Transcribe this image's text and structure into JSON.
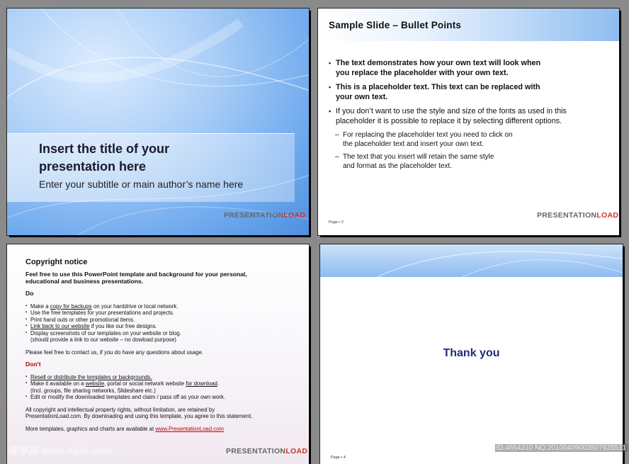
{
  "slide1": {
    "title_line1": "Insert the title of your",
    "title_line2": "presentation here",
    "subtitle": "Enter your subtitle or main author’s name here",
    "logo_a": "PRESENTATION",
    "logo_b": "LOAD"
  },
  "slide2": {
    "title": "Sample Slide – Bullet Points",
    "bullets": [
      {
        "l1": "The text demonstrates how your own text will look when",
        "l2": "you replace the placeholder with your own text."
      },
      {
        "l1": "This is a placeholder text. This text can be replaced with",
        "l2": "your own text."
      },
      {
        "l1": "If you don’t want to use the style and size of the fonts as used in this",
        "l2": "placeholder it is possible to replace it by selecting different options."
      }
    ],
    "subbullets": [
      {
        "l1": "For replacing the placeholder text you need to click on",
        "l2": "the placeholder text and insert your own text."
      },
      {
        "l1": "The text that you insert will retain the same style",
        "l2": "and format as the placeholder text."
      }
    ],
    "page": "Page ▪ 2",
    "logo_a": "PRESENTATION",
    "logo_b": "LOAD"
  },
  "slide3": {
    "title": "Copyright notice",
    "intro_l1": "Feel free to use this PowerPoint template and background for your personal,",
    "intro_l2": "educational and business presentations.",
    "do_heading": "Do",
    "do_items": {
      "i1_pre": "Make a ",
      "i1_link": "copy for backups",
      "i1_post": " on your harddrive or local network.",
      "i2": "Use the free templates for your presentations and projects.",
      "i3": "Print hand outs or other promotional items.",
      "i4_link": "Link back to our website",
      "i4_post": " if you like our free designs.",
      "i5_l1": "Display screenshots of our templates on your website or blog.",
      "i5_l2": "(should provide a link to our website – no dowload purpose)"
    },
    "contact": "Please feel free to contact us, if you do have any questions about usage.",
    "dont_heading": "Don't",
    "dont_items": {
      "d1": "Resell or distribute the templates or backgrounds.",
      "d2_pre": "Make it available on a ",
      "d2_link1": "website",
      "d2_mid": ", portal or social network website ",
      "d2_link2": "for download",
      "d2_post": ".",
      "d2_l2": "(Incl. groups, file sharing networks, Slideshare etc.)",
      "d3": "Edit or modify the downloaded templates and claim / pass off as your own work."
    },
    "rights_l1": "All copyright and intellectual property rights, without limitation, are retained by",
    "rights_l2": "PresentationLoad.com. By downloading and using this template, you agree to this statement.",
    "more_pre": "More templates, graphics and charts are available at ",
    "more_link": "www.PresentationLoad.com",
    "logo_a": "PRESENTATION",
    "logo_b": "LOAD"
  },
  "slide4": {
    "thanks": "Thank you",
    "page": "Page ▪ 4"
  },
  "watermark": "昵享网 www.nipic.com",
  "id_tag": "ID:4654310 NO:20100409003507925531"
}
